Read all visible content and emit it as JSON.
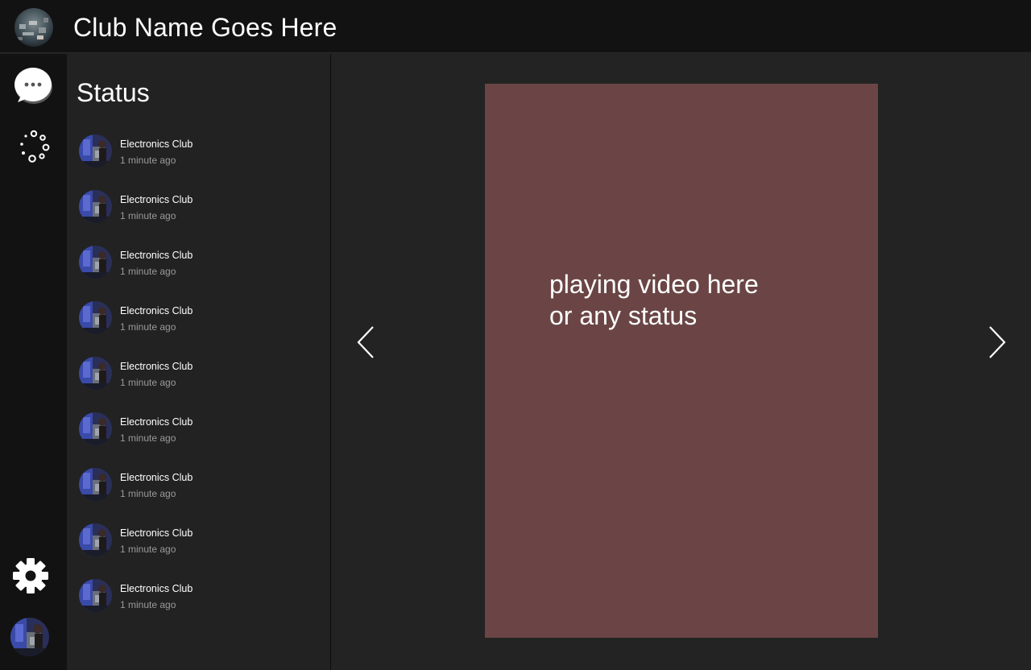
{
  "header": {
    "club_title": "Club Name Goes Here"
  },
  "rail": {
    "icons": [
      "chat-icon",
      "status-ring-icon",
      "gear-icon",
      "user-avatar"
    ]
  },
  "status_panel": {
    "heading": "Status",
    "items": [
      {
        "name": "Electronics Club",
        "time": "1 minute ago"
      },
      {
        "name": "Electronics Club",
        "time": "1 minute ago"
      },
      {
        "name": "Electronics Club",
        "time": "1 minute ago"
      },
      {
        "name": "Electronics Club",
        "time": "1 minute ago"
      },
      {
        "name": "Electronics Club",
        "time": "1 minute ago"
      },
      {
        "name": "Electronics Club",
        "time": "1 minute ago"
      },
      {
        "name": "Electronics Club",
        "time": "1 minute ago"
      },
      {
        "name": "Electronics Club",
        "time": "1 minute ago"
      },
      {
        "name": "Electronics Club",
        "time": "1 minute ago"
      }
    ]
  },
  "viewer": {
    "placeholder_text": "playing video here\nor any status",
    "prev_icon": "chevron-left-icon",
    "next_icon": "chevron-right-icon"
  },
  "colors": {
    "background": "#222222",
    "header_bg": "#121212",
    "rail_bg": "#121212",
    "video_card": "#6b4545",
    "text_primary": "#ffffff",
    "text_secondary": "#9a9a9a"
  }
}
